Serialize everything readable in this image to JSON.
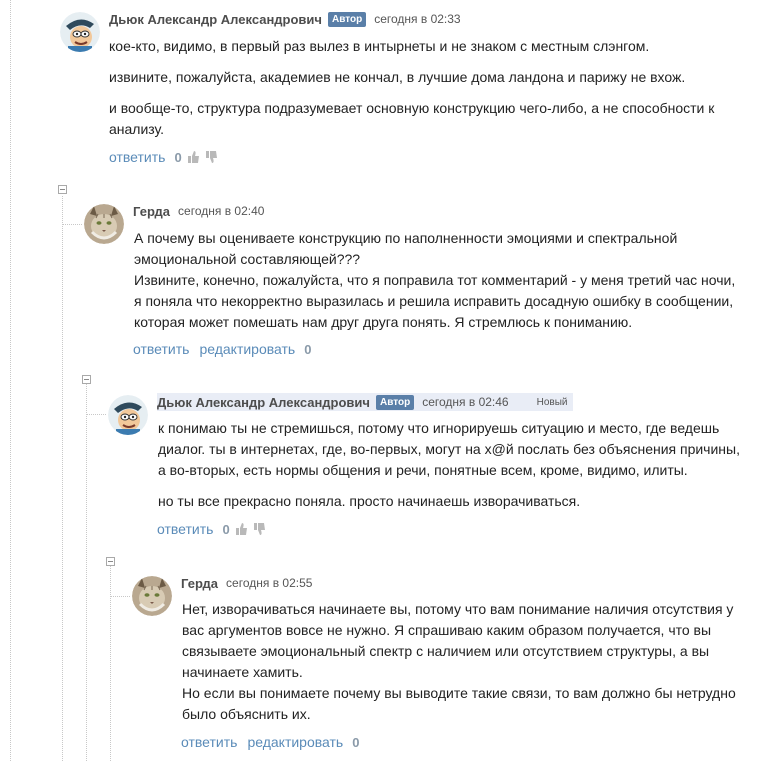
{
  "comments": [
    {
      "author": "Дьюк Александр Александрович",
      "badge": "Автор",
      "time": "сегодня в 02:33",
      "paragraphs": [
        "кое-кто, видимо, в первый раз вылез в интырнеты и не знаком с местным слэнгом.",
        "извините, пожалуйста, академиев не кончал, в лучшие дома ландона и парижу не вхож.",
        "и вообще-то, структура подразумевает основную конструкцию чего-либо, а не способности к анализу."
      ],
      "reply_label": "ответить",
      "score": "0",
      "avatar_icon": "cartoon-man-hat-avatar"
    },
    {
      "author": "Герда",
      "time": "сегодня в 02:40",
      "paragraphs": [
        "А почему вы оцениваете конструкцию по наполненности эмоциями и  спектральной эмоциональной составляющей???",
        "Извините, конечно, пожалуйста, что я поправила тот комментарий - у меня третий час ночи, я поняла что некорректно выразилась и решила исправить досадную ошибку в сообщении, которая может помешать нам друг друга понять. Я стремлюсь к пониманию."
      ],
      "reply_label": "ответить",
      "edit_label": "редактировать",
      "score": "0",
      "avatar_icon": "lynx-avatar"
    },
    {
      "author": "Дьюк Александр Александрович",
      "badge": "Автор",
      "time": "сегодня в 02:46",
      "new_label": "Новый",
      "paragraphs": [
        "к понимаю ты не стремишься, потому что игнорируешь ситуацию и место, где ведешь диалог. ты в интернетах, где, во-первых, могут на х@й послать без объяснения причины, а во-вторых, есть нормы общения и речи, понятные всем, кроме, видимо, илиты.",
        "но ты все прекрасно поняла. просто начинаешь изворачиваться."
      ],
      "reply_label": "ответить",
      "score": "0",
      "avatar_icon": "cartoon-man-hat-avatar"
    },
    {
      "author": "Герда",
      "time": "сегодня в 02:55",
      "paragraphs": [
        "Нет, изворачиваться начинаете вы, потому что вам понимание наличия отсутствия у вас аргументов вовсе не нужно. Я спрашиваю каким образом получается, что вы связываете эмоциональный спектр с наличием или отсутствием структуры, а вы начинаете хамить.",
        "Но если вы понимаете почему вы выводите такие связи, то вам должно бы нетрудно было объяснить их."
      ],
      "reply_label": "ответить",
      "edit_label": "редактировать",
      "score": "0",
      "avatar_icon": "lynx-avatar"
    }
  ]
}
